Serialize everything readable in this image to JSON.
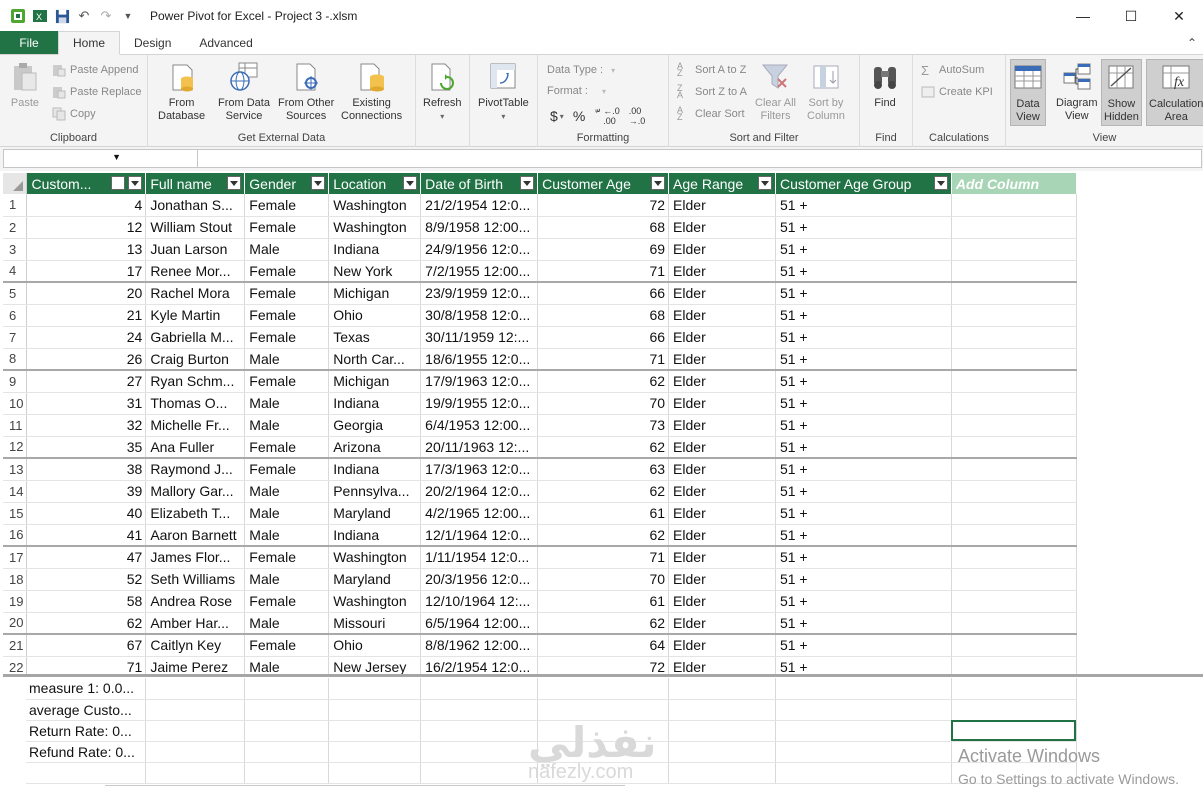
{
  "window": {
    "title": "Power Pivot for Excel - Project 3 -.xlsm",
    "controls": [
      "minimize-icon",
      "maximize-icon",
      "close-icon"
    ]
  },
  "tabs": [
    {
      "label": "File"
    },
    {
      "label": "Home"
    },
    {
      "label": "Design"
    },
    {
      "label": "Advanced"
    }
  ],
  "ribbon": {
    "clipboard": {
      "label": "Clipboard",
      "paste": "Paste",
      "paste_append": "Paste Append",
      "paste_replace": "Paste Replace",
      "copy": "Copy"
    },
    "external": {
      "label": "Get External Data",
      "from_database": [
        "From",
        "Database"
      ],
      "from_data_service": [
        "From Data",
        "Service"
      ],
      "from_other_sources": [
        "From Other",
        "Sources"
      ],
      "existing_connections": [
        "Existing",
        "Connections"
      ]
    },
    "refresh": "Refresh",
    "pivottable": "PivotTable",
    "formatting": {
      "label": "Formatting",
      "data_type": "Data Type :",
      "format": "Format :",
      "currency": "$",
      "percent": "%",
      "comma": "ّ"
    },
    "sortfilter": {
      "label": "Sort and Filter",
      "sort_az": "Sort A to Z",
      "sort_za": "Sort Z to A",
      "clear_sort": "Clear Sort",
      "clear_all_filters": [
        "Clear All",
        "Filters"
      ],
      "sort_by_column": [
        "Sort by",
        "Column"
      ]
    },
    "find": {
      "label": "Find",
      "button": "Find"
    },
    "calculations": {
      "label": "Calculations",
      "autosum": "AutoSum",
      "create_kpi": "Create KPI"
    },
    "view": {
      "label": "View",
      "data_view": [
        "Data",
        "View"
      ],
      "diagram_view": [
        "Diagram",
        "View"
      ],
      "show_hidden": [
        "Show",
        "Hidden"
      ],
      "calculation_area": [
        "Calculation",
        "Area"
      ]
    }
  },
  "columns": [
    "Custom...",
    "Full name",
    "Gender",
    "Location",
    "Date of Birth",
    "Customer Age",
    "Age Range",
    "Customer Age Group",
    "Add Column"
  ],
  "rows": [
    [
      "1",
      "4",
      "Jonathan S...",
      "Female",
      "Washington",
      "21/2/1954 12:0...",
      "72",
      "Elder",
      "51 +"
    ],
    [
      "2",
      "12",
      "William Stout",
      "Female",
      "Washington",
      "8/9/1958 12:00...",
      "68",
      "Elder",
      "51 +"
    ],
    [
      "3",
      "13",
      "Juan Larson",
      "Male",
      "Indiana",
      "24/9/1956 12:0...",
      "69",
      "Elder",
      "51 +"
    ],
    [
      "4",
      "17",
      "Renee Mor...",
      "Female",
      "New York",
      "7/2/1955 12:00...",
      "71",
      "Elder",
      "51 +"
    ],
    [
      "5",
      "20",
      "Rachel Mora",
      "Female",
      "Michigan",
      "23/9/1959 12:0...",
      "66",
      "Elder",
      "51 +"
    ],
    [
      "6",
      "21",
      "Kyle Martin",
      "Female",
      "Ohio",
      "30/8/1958 12:0...",
      "68",
      "Elder",
      "51 +"
    ],
    [
      "7",
      "24",
      "Gabriella M...",
      "Female",
      "Texas",
      "30/11/1959 12:...",
      "66",
      "Elder",
      "51 +"
    ],
    [
      "8",
      "26",
      "Craig Burton",
      "Male",
      "North Car...",
      "18/6/1955 12:0...",
      "71",
      "Elder",
      "51 +"
    ],
    [
      "9",
      "27",
      "Ryan Schm...",
      "Female",
      "Michigan",
      "17/9/1963 12:0...",
      "62",
      "Elder",
      "51 +"
    ],
    [
      "10",
      "31",
      "Thomas O...",
      "Male",
      "Indiana",
      "19/9/1955 12:0...",
      "70",
      "Elder",
      "51 +"
    ],
    [
      "11",
      "32",
      "Michelle Fr...",
      "Male",
      "Georgia",
      "6/4/1953 12:00...",
      "73",
      "Elder",
      "51 +"
    ],
    [
      "12",
      "35",
      "Ana Fuller",
      "Female",
      "Arizona",
      "20/11/1963 12:...",
      "62",
      "Elder",
      "51 +"
    ],
    [
      "13",
      "38",
      "Raymond J...",
      "Female",
      "Indiana",
      "17/3/1963 12:0...",
      "63",
      "Elder",
      "51 +"
    ],
    [
      "14",
      "39",
      "Mallory Gar...",
      "Male",
      "Pennsylva...",
      "20/2/1964 12:0...",
      "62",
      "Elder",
      "51 +"
    ],
    [
      "15",
      "40",
      "Elizabeth T...",
      "Male",
      "Maryland",
      "4/2/1965 12:00...",
      "61",
      "Elder",
      "51 +"
    ],
    [
      "16",
      "41",
      "Aaron Barnett",
      "Male",
      "Indiana",
      "12/1/1964 12:0...",
      "62",
      "Elder",
      "51 +"
    ],
    [
      "17",
      "47",
      "James Flor...",
      "Female",
      "Washington",
      "1/11/1954 12:0...",
      "71",
      "Elder",
      "51 +"
    ],
    [
      "18",
      "52",
      "Seth Williams",
      "Male",
      "Maryland",
      "20/3/1956 12:0...",
      "70",
      "Elder",
      "51 +"
    ],
    [
      "19",
      "58",
      "Andrea Rose",
      "Female",
      "Washington",
      "12/10/1964 12:...",
      "61",
      "Elder",
      "51 +"
    ],
    [
      "20",
      "62",
      "Amber Har...",
      "Male",
      "Missouri",
      "6/5/1964 12:00...",
      "62",
      "Elder",
      "51 +"
    ],
    [
      "21",
      "67",
      "Caitlyn Key",
      "Female",
      "Ohio",
      "8/8/1962 12:00...",
      "64",
      "Elder",
      "51 +"
    ],
    [
      "22",
      "71",
      "Jaime Perez",
      "Male",
      "New Jersey",
      "16/2/1954 12:0...",
      "72",
      "Elder",
      "51 +"
    ]
  ],
  "measures": [
    "measure 1: 0.0...",
    "average Custo...",
    "Return Rate: 0...",
    "Refund Rate: 0..."
  ],
  "activation": {
    "line1": "Activate Windows",
    "line2": "Go to Settings to activate Windows."
  },
  "watermark": {
    "line1": "نفذلي",
    "line2": "nafezly.com"
  },
  "colors": {
    "header_green": "#217346",
    "add_column": "#a8d5b6",
    "ribbon_bg": "#f4f4f4"
  }
}
